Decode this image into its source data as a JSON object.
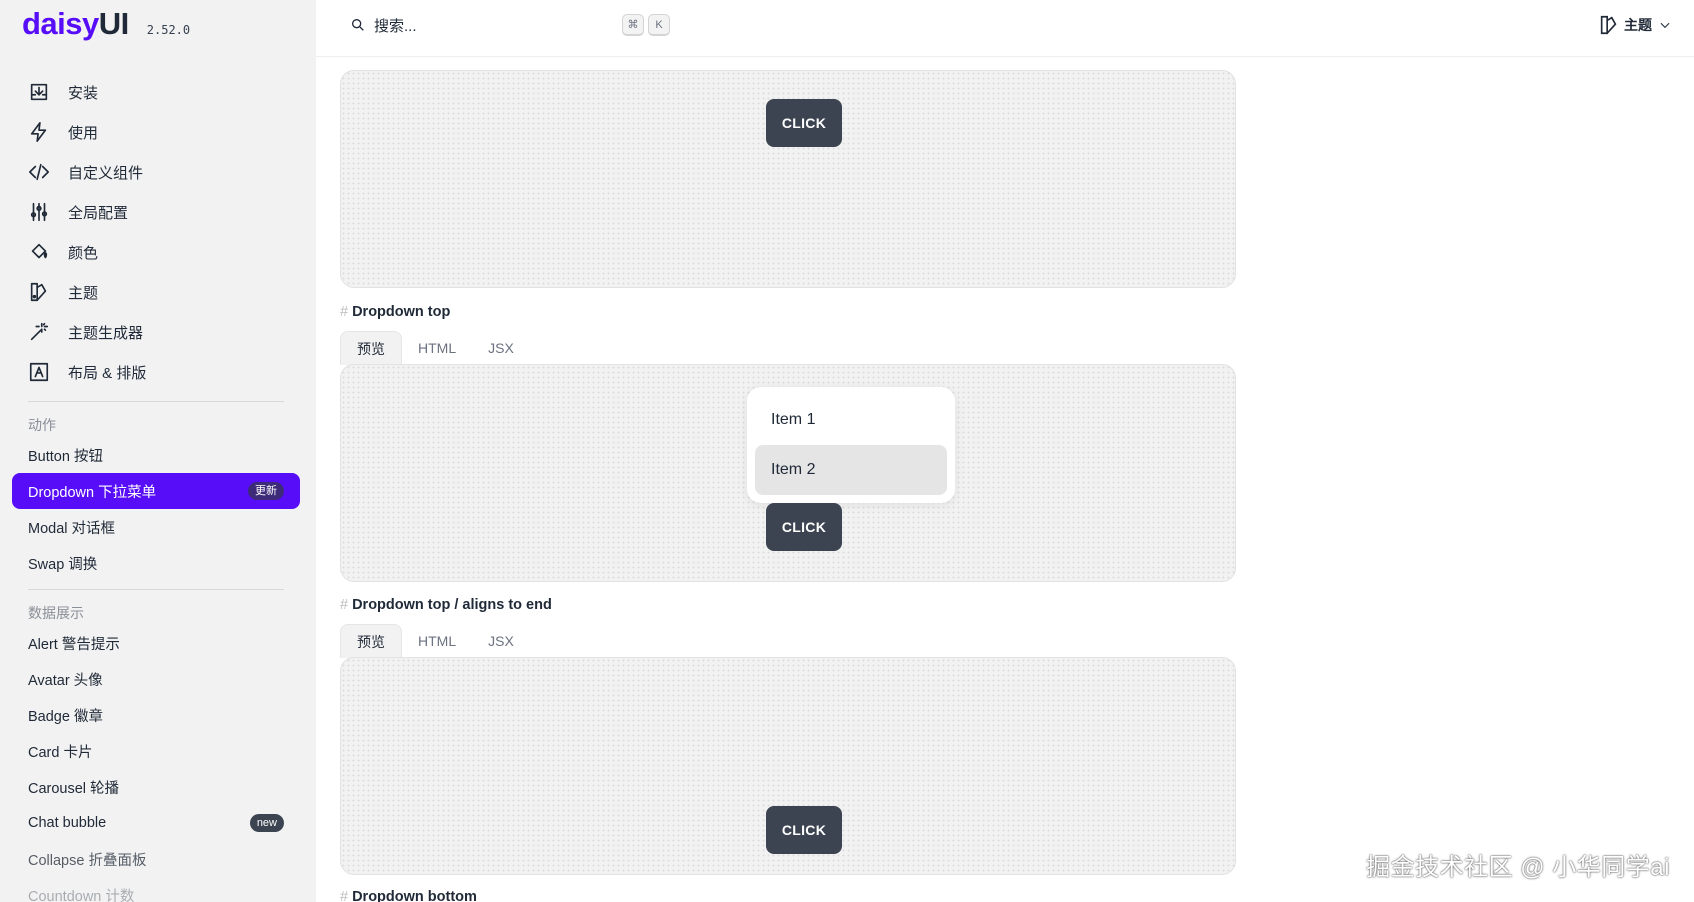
{
  "brand": {
    "logo_main": "daisy",
    "logo_ui": "UI",
    "version": "2.52.0"
  },
  "main_nav": [
    {
      "label": "安装",
      "icon": "download-box-icon"
    },
    {
      "label": "使用",
      "icon": "lightning-icon"
    },
    {
      "label": "自定义组件",
      "icon": "code-icon"
    },
    {
      "label": "全局配置",
      "icon": "sliders-icon"
    },
    {
      "label": "颜色",
      "icon": "paint-bucket-icon"
    },
    {
      "label": "主题",
      "icon": "swatch-icon"
    },
    {
      "label": "主题生成器",
      "icon": "magic-wand-icon"
    },
    {
      "label": "布局 & 排版",
      "icon": "typography-icon"
    }
  ],
  "actions": {
    "title": "动作",
    "items": [
      {
        "label": "Button 按钮"
      },
      {
        "label": "Dropdown 下拉菜单",
        "badge": "更新",
        "active": true
      },
      {
        "label": "Modal 对话框"
      },
      {
        "label": "Swap 调换"
      }
    ]
  },
  "display": {
    "title": "数据展示",
    "items": [
      {
        "label": "Alert 警告提示"
      },
      {
        "label": "Avatar 头像"
      },
      {
        "label": "Badge 徽章"
      },
      {
        "label": "Card 卡片"
      },
      {
        "label": "Carousel 轮播"
      },
      {
        "label": "Chat bubble",
        "badge": "new"
      },
      {
        "label": "Collapse 折叠面板"
      },
      {
        "label": "Countdown 计数"
      }
    ]
  },
  "topbar": {
    "search_placeholder": "搜索...",
    "kbd_cmd": "⌘",
    "kbd_k": "K",
    "theme_label": "主题"
  },
  "tabs": {
    "preview": "预览",
    "html": "HTML",
    "jsx": "JSX"
  },
  "sections": [
    {
      "title": "Dropdown top",
      "button": "CLICK",
      "menu": [
        "Item 1",
        "Item 2"
      ]
    },
    {
      "title": "Dropdown top / aligns to end",
      "button": "CLICK"
    },
    {
      "title": "Dropdown bottom"
    }
  ],
  "first_preview": {
    "button": "CLICK"
  },
  "watermark": "掘金技术社区 @ 小华同学ai"
}
